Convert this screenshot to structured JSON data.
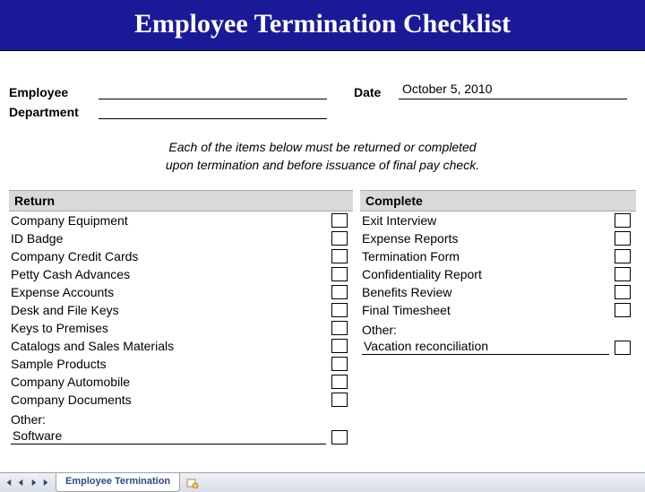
{
  "banner": {
    "title": "Employee Termination Checklist"
  },
  "meta": {
    "employee_label": "Employee",
    "employee_value": "",
    "department_label": "Department",
    "department_value": "",
    "date_label": "Date",
    "date_value": "October 5, 2010"
  },
  "instructions": {
    "line1": "Each of the items below must be returned or completed",
    "line2": "upon termination and before issuance of final pay check."
  },
  "return": {
    "heading": "Return",
    "items": [
      "Company Equipment",
      "ID Badge",
      "Company Credit Cards",
      "Petty Cash Advances",
      "Expense Accounts",
      "Desk and File Keys",
      "Keys to Premises",
      "Catalogs and Sales Materials",
      "Sample Products",
      "Company Automobile",
      "Company Documents"
    ],
    "other_label": "Other:",
    "other_value": "Software"
  },
  "complete": {
    "heading": "Complete",
    "items": [
      "Exit Interview",
      "Expense Reports",
      "Termination Form",
      "Confidentiality Report",
      "Benefits Review",
      "Final Timesheet"
    ],
    "other_label": "Other:",
    "other_value": "Vacation reconciliation"
  },
  "tabs": {
    "active": "Employee Termination"
  }
}
